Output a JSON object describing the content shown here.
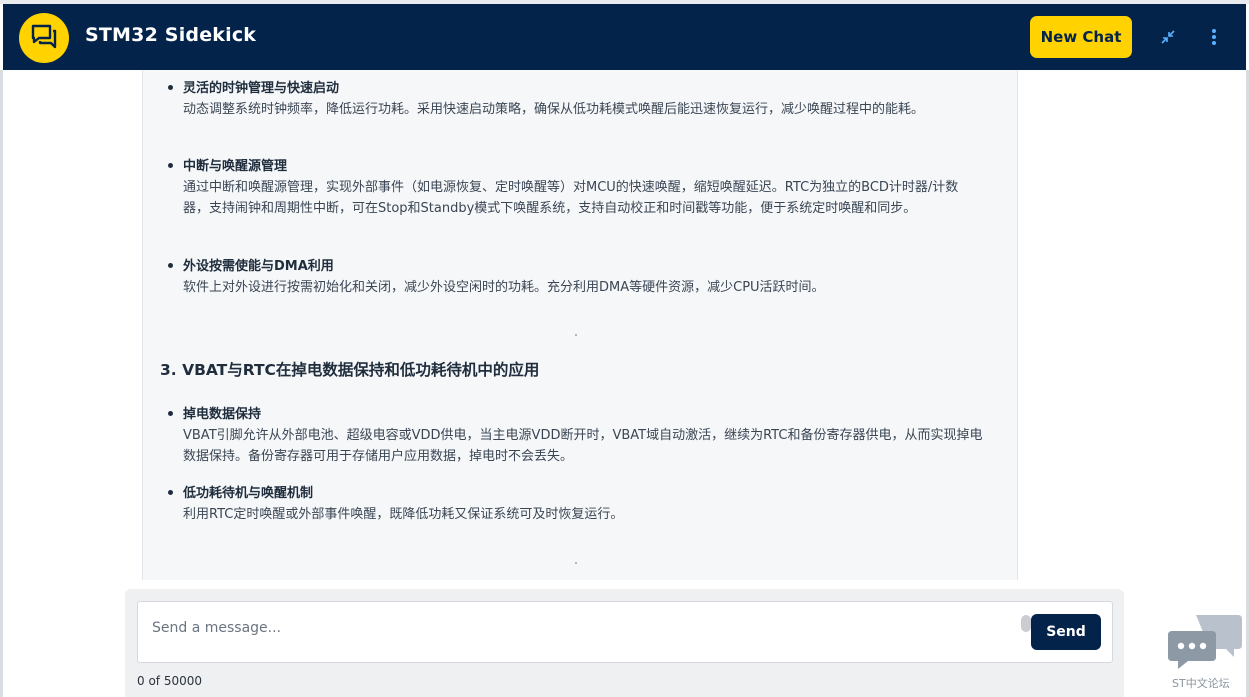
{
  "header": {
    "title": "STM32 Sidekick",
    "new_chat_label": "New Chat",
    "icons": [
      "chat-bubbles-icon",
      "collapse-icon",
      "more-vertical-icon"
    ],
    "brand_color": "#03234b",
    "accent_color": "#ffd200"
  },
  "content": {
    "bullets_top": [
      {
        "title": "灵活的时钟管理与快速启动",
        "body": "动态调整系统时钟频率，降低运行功耗。采用快速启动策略，确保从低功耗模式唤醒后能迅速恢复运行，减少唤醒过程中的能耗。"
      },
      {
        "title": "中断与唤醒源管理",
        "body": "通过中断和唤醒源管理，实现外部事件（如电源恢复、定时唤醒等）对MCU的快速唤醒，缩短唤醒延迟。RTC为独立的BCD计时器/计数器，支持闹钟和周期性中断，可在Stop和Standby模式下唤醒系统，支持自动校正和时间戳等功能，便于系统定时唤醒和同步。"
      },
      {
        "title": "外设按需使能与DMA利用",
        "body": "软件上对外设进行按需初始化和关闭，减少外设空闲时的功耗。充分利用DMA等硬件资源，减少CPU活跃时间。"
      }
    ],
    "section_title": "3. VBAT与RTC在掉电数据保持和低功耗待机中的应用",
    "bullets_bottom": [
      {
        "title": "掉电数据保持",
        "body": "VBAT引脚允许从外部电池、超级电容或VDD供电，当主电源VDD断开时，VBAT域自动激活，继续为RTC和备份寄存器供电，从而实现掉电数据保持。备份寄存器可用于存储用户应用数据，掉电时不会丢失。"
      },
      {
        "title": "低功耗待机与唤醒机制",
        "body": "利用RTC定时唤醒或外部事件唤醒，既降低功耗又保证系统可及时恢复运行。"
      }
    ]
  },
  "composer": {
    "placeholder": "Send a message...",
    "value": "",
    "send_label": "Send",
    "char_count": "0 of 50000"
  },
  "forum_badge": {
    "label": "ST中文论坛",
    "icon": "chat-bubbles-icon"
  }
}
